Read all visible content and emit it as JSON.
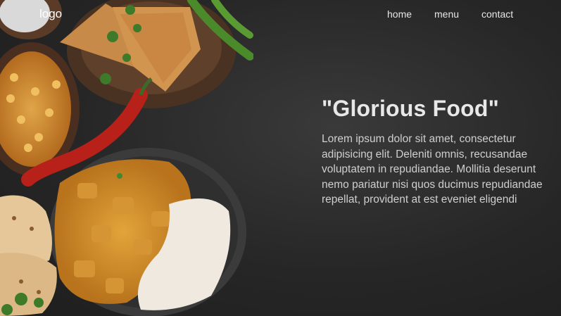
{
  "nav": {
    "logo": "logo",
    "links": [
      {
        "label": "home"
      },
      {
        "label": "menu"
      },
      {
        "label": "contact"
      }
    ]
  },
  "hero": {
    "title": "\"Glorious Food\"",
    "body": "Lorem ipsum dolor sit amet, consectetur adipisicing elit. Deleniti omnis, recusandae voluptatem in repudiandae. Mollitia deserunt nemo pariatur nisi quos ducimus repudiandae repellat, provident at est eveniet eligendi"
  },
  "colors": {
    "background": "#262626",
    "text": "#e8e8e8"
  }
}
